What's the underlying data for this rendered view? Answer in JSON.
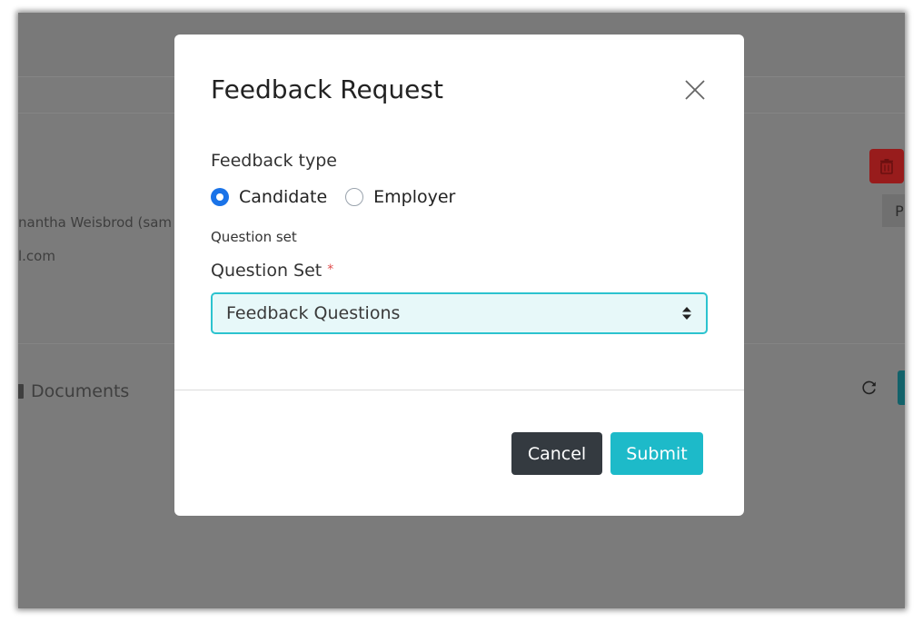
{
  "background": {
    "contact_name": "nantha Weisbrod (sam",
    "contact_email": "l.com",
    "documents_label": "Documents",
    "side_button_label": "P",
    "icons": {
      "delete": "trash-icon",
      "document": "document-icon",
      "refresh": "refresh-icon"
    }
  },
  "modal": {
    "title": "Feedback Request",
    "close_icon": "close-icon",
    "feedback_type": {
      "label": "Feedback type",
      "options": [
        {
          "label": "Candidate",
          "selected": true
        },
        {
          "label": "Employer",
          "selected": false
        }
      ]
    },
    "question_set_caption": "Question set",
    "question_set": {
      "label": "Question Set",
      "required_marker": "*",
      "selected_value": "Feedback Questions"
    },
    "buttons": {
      "cancel": "Cancel",
      "submit": "Submit"
    }
  },
  "colors": {
    "radio_selected": "#1a73e8",
    "select_border": "#2cc3cf",
    "select_background": "#e7f8f9",
    "cancel_button": "#343a40",
    "submit_button": "#1dbac9",
    "delete_button": "#981c1c",
    "overlay": "#7b7b7b"
  }
}
